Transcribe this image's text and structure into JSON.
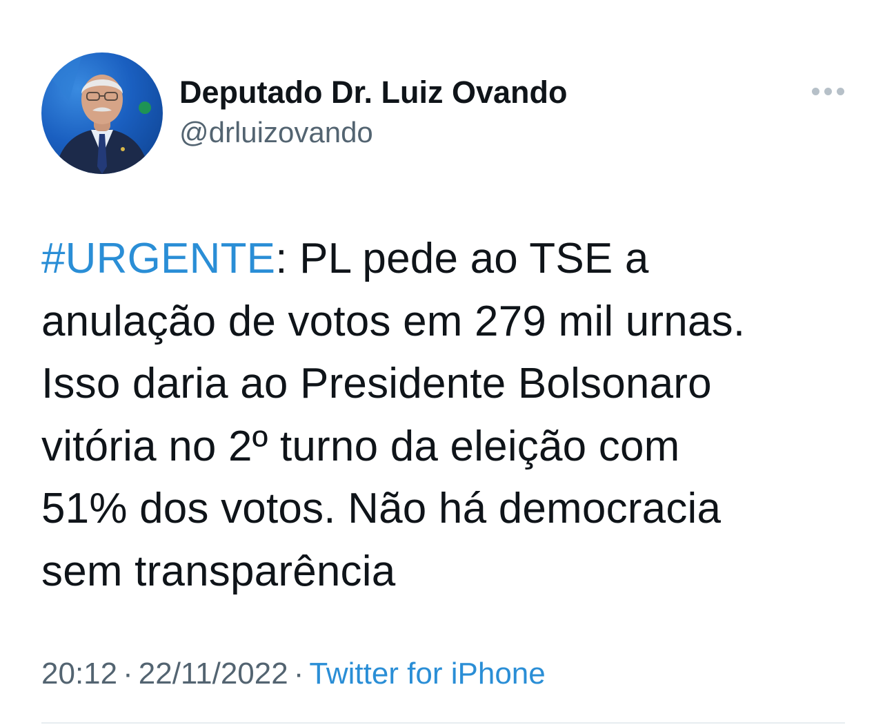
{
  "tweet": {
    "author": {
      "display_name": "Deputado Dr. Luiz Ovando",
      "handle": "@drluizovando"
    },
    "more_icon": "more-horizontal-icon",
    "body": {
      "hashtag": "#URGENTE",
      "lines": [
        ": PL pede ao TSE a",
        "anulação de votos em 279 mil urnas.",
        "Isso daria ao Presidente Bolsonaro",
        "vitória no 2º turno da eleição com",
        "51% dos votos. Não há democracia",
        "sem transparência"
      ]
    },
    "meta": {
      "time": "20:12",
      "date": "22/11/2022",
      "separator": "·",
      "source": "Twitter for iPhone"
    },
    "colors": {
      "link": "#2a8ed6",
      "text": "#0f1419",
      "secondary": "#536471"
    }
  }
}
